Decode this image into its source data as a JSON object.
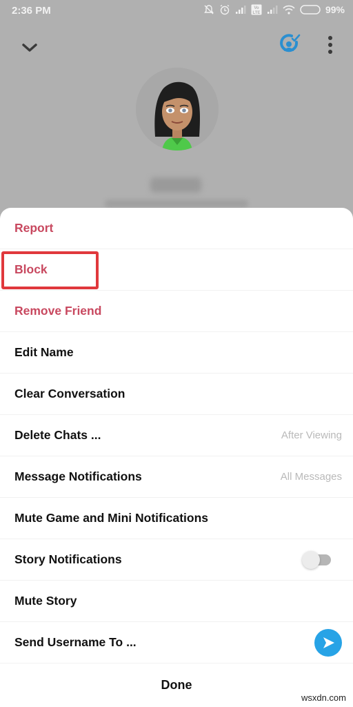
{
  "status_bar": {
    "time": "2:36 PM",
    "battery": "99%",
    "icons": [
      "notifications-off-icon",
      "alarm-icon",
      "signal-icon",
      "volte-icon",
      "signal-icon",
      "wifi-icon",
      "battery-icon"
    ],
    "volte_label": "Vo LTE"
  },
  "header": {
    "back_icon": "chevron-down-icon",
    "friendship_icon": "friend-check-icon",
    "menu_icon": "more-vertical-icon",
    "accent_color": "#2b8fd0"
  },
  "profile": {
    "avatar": "bitmoji-avatar",
    "name_blurred": true,
    "username_blurred": true
  },
  "menu": {
    "items": [
      {
        "label": "Report",
        "style": "danger"
      },
      {
        "label": "Block",
        "style": "danger",
        "highlighted": true
      },
      {
        "label": "Remove Friend",
        "style": "danger"
      },
      {
        "label": "Edit Name"
      },
      {
        "label": "Clear Conversation"
      },
      {
        "label": "Delete Chats ...",
        "value": "After Viewing"
      },
      {
        "label": "Message Notifications",
        "value": "All Messages"
      },
      {
        "label": "Mute Game and Mini Notifications"
      },
      {
        "label": "Story Notifications",
        "toggle": false
      },
      {
        "label": "Mute Story"
      },
      {
        "label": "Send Username To ...",
        "action_icon": "send-icon"
      }
    ],
    "done_label": "Done",
    "danger_color": "#c8485f",
    "highlight_color": "#e0383c"
  },
  "watermark": "wsxdn.com"
}
